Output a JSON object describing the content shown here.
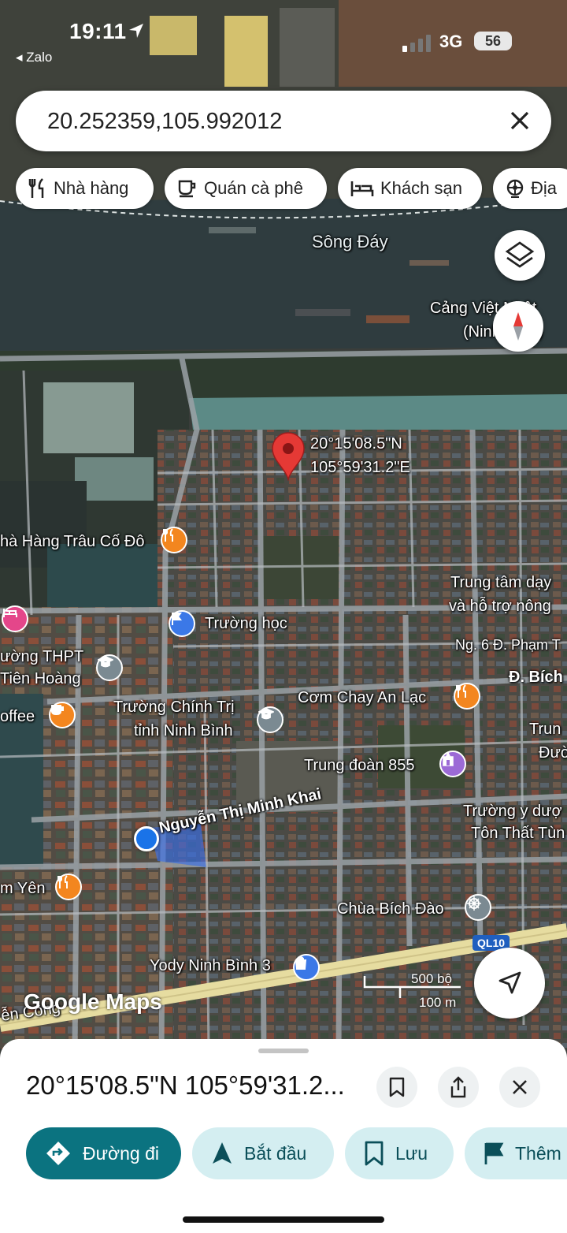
{
  "status_bar": {
    "time": "19:11",
    "back_app": "◂ Zalo",
    "network": "3G",
    "battery": "56"
  },
  "search": {
    "value": "20.252359,105.992012"
  },
  "chips": [
    {
      "label": "Nhà hàng",
      "icon": "restaurant-icon"
    },
    {
      "label": "Quán cà phê",
      "icon": "coffee-icon"
    },
    {
      "label": "Khách sạn",
      "icon": "hotel-icon"
    },
    {
      "label": "Địa",
      "icon": "attractions-icon"
    }
  ],
  "map": {
    "pin_label": {
      "line1": "20°15'08.5\"N",
      "line2": "105°59'31.2\"E"
    },
    "labels": {
      "river": "Sông Đáy",
      "port1": "Cảng Việt Nhật",
      "port2": "(Ninh Bình)",
      "restaurant_trau": "hà Hàng Trâu Cố Đô",
      "school": "Trường học",
      "training1": "Trung tâm dạy",
      "training2": "và hỗ trợ nông",
      "alley": "Ng. 6 Đ. Phạm T",
      "thpt1": "ường THPT",
      "thpt2": "Tiên Hoàng",
      "bich": "Đ. Bích",
      "com_chay": "Cơm Chay An Lạc",
      "coffee": "offee",
      "politics1": "Trường Chính Trị",
      "politics2": "tỉnh Ninh Bình",
      "trun1": "Trun",
      "trun2": "Đườ",
      "regiment": "Trung đoàn 855",
      "street": "Nguyễn Thị Minh Khai",
      "medical1": "Trường y dượ",
      "medical2": "Tôn Thất Tùn",
      "yen": "m Yên",
      "pagoda": "Chùa Bích Đào",
      "ql10": "QL10",
      "yody": "Yody Ninh Bình 3",
      "road_bottom": "ễn Công",
      "google": "Google Maps"
    },
    "scale": {
      "imperial": "500 bộ",
      "metric": "100 m"
    }
  },
  "sheet": {
    "title": "20°15'08.5\"N 105°59'31.2...",
    "actions": [
      {
        "label": "Đường đi",
        "icon": "directions-icon"
      },
      {
        "label": "Bắt đầu",
        "icon": "navigation-arrow-icon"
      },
      {
        "label": "Lưu",
        "icon": "bookmark-icon"
      },
      {
        "label": "Thêm",
        "icon": "flag-icon"
      }
    ]
  },
  "colors": {
    "accent": "#0b7380",
    "pin": "#e53935",
    "location_dot": "#1a73e8",
    "chip_secondary": "#d4eef1"
  }
}
